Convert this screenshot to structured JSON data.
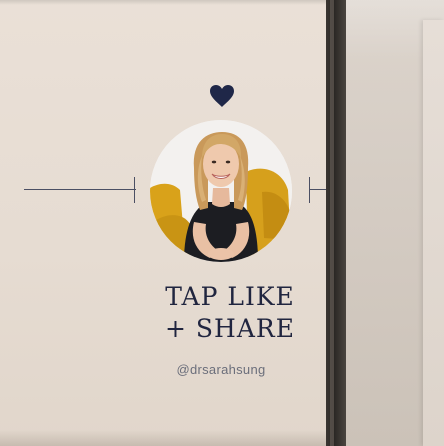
{
  "post": {
    "headline_line1": "TAP LIKE",
    "headline_line2": "+ SHARE",
    "handle": "@drsarahsung"
  },
  "icons": {
    "top_icon": "heart-icon"
  },
  "colors": {
    "card_background": "#e8ded5",
    "text_navy": "#20253f",
    "heart": "#1f2748",
    "divider": "#2d2a27",
    "handle_text": "#6b6e7b"
  }
}
